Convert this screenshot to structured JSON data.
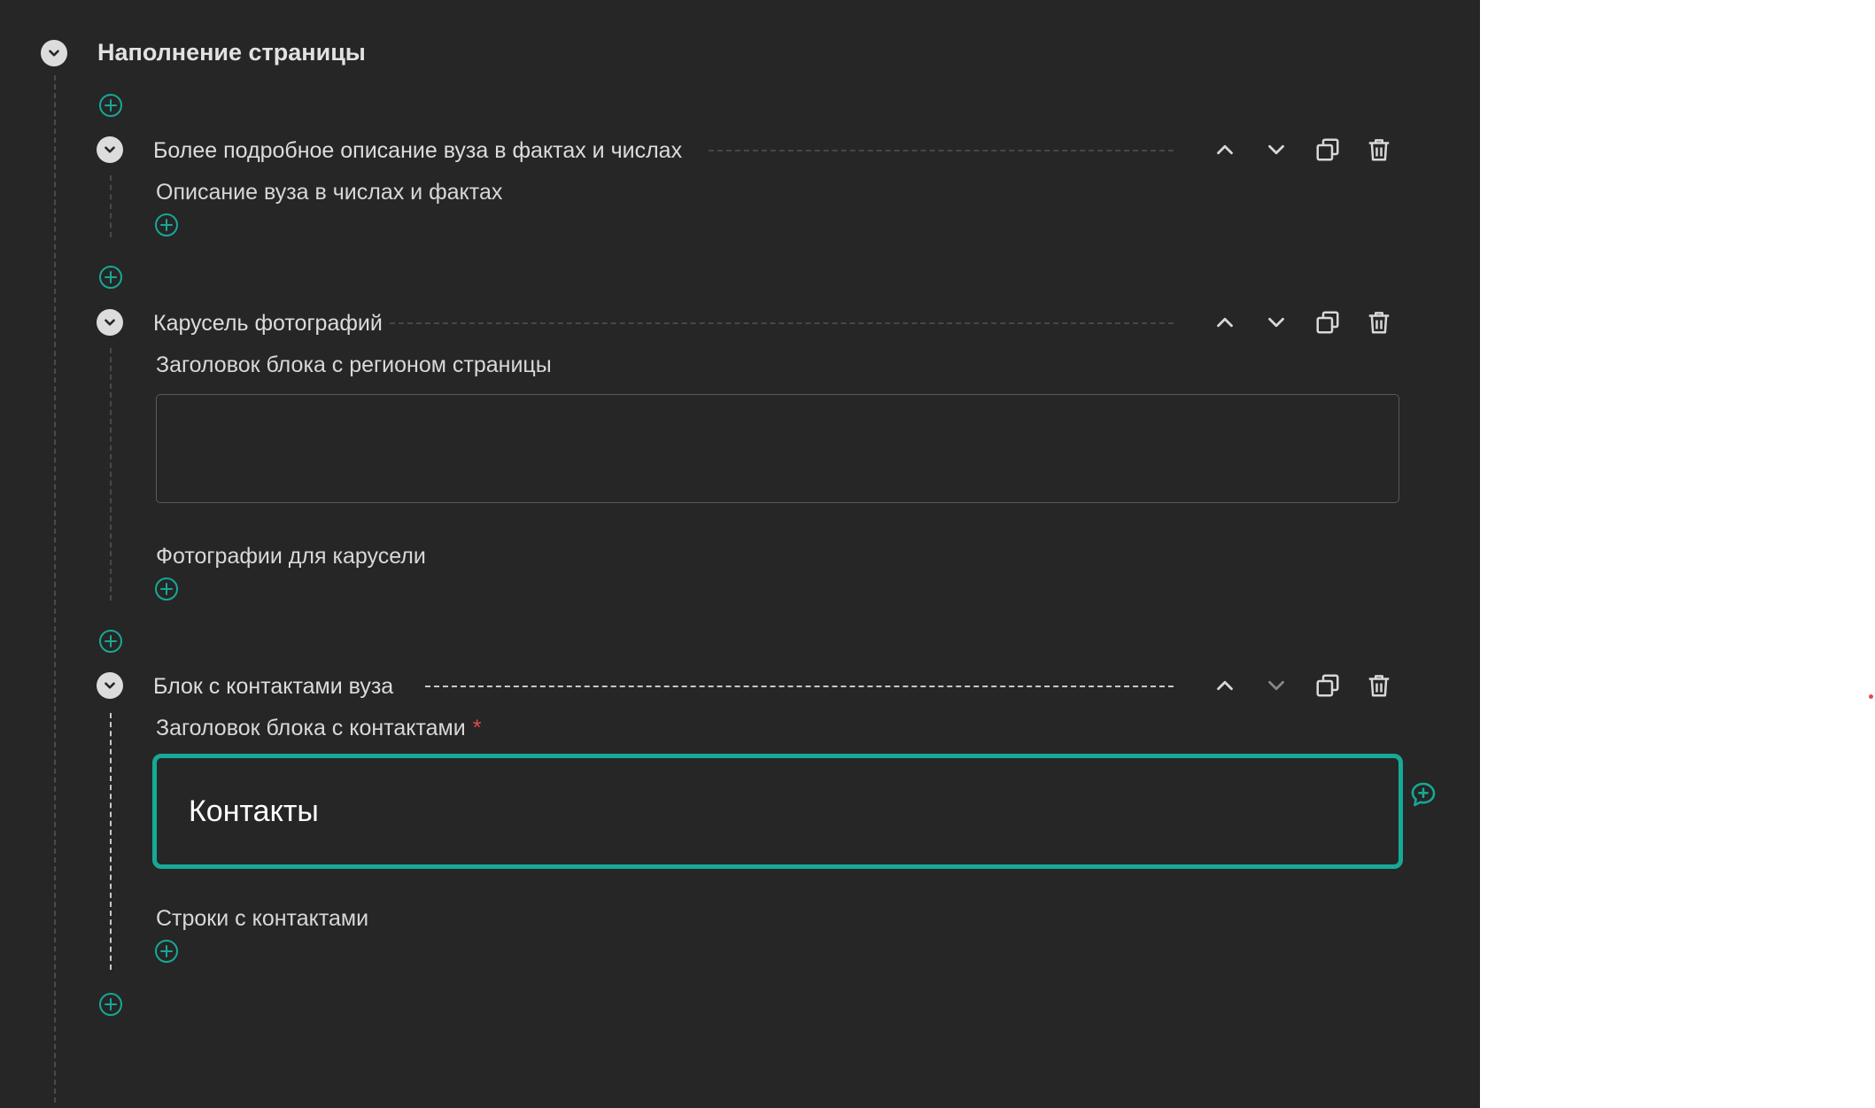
{
  "section": {
    "title": "Наполнение страницы"
  },
  "blocks": [
    {
      "title": "Более подробное описание вуза в фактах и числах",
      "fields": [
        {
          "label": "Описание вуза в числах и фактах"
        }
      ]
    },
    {
      "title": "Карусель фотографий",
      "fields": [
        {
          "label": "Заголовок блока с регионом страницы",
          "value": ""
        },
        {
          "label": "Фотографии для карусели"
        }
      ]
    },
    {
      "title": "Блок с контактами вуза",
      "fields": [
        {
          "label": "Заголовок блока с контактами",
          "required_mark": "*",
          "value": "Контакты"
        },
        {
          "label": "Строки с контактами"
        }
      ]
    }
  ],
  "colors": {
    "panel_bg": "#262626",
    "accent": "#17a896",
    "required": "#e34b4b",
    "page_bg": "#ffffff"
  },
  "icons": [
    "chevron-down-icon",
    "plus-icon",
    "chevron-up-icon",
    "copy-icon",
    "trash-icon",
    "comment-add-icon"
  ]
}
